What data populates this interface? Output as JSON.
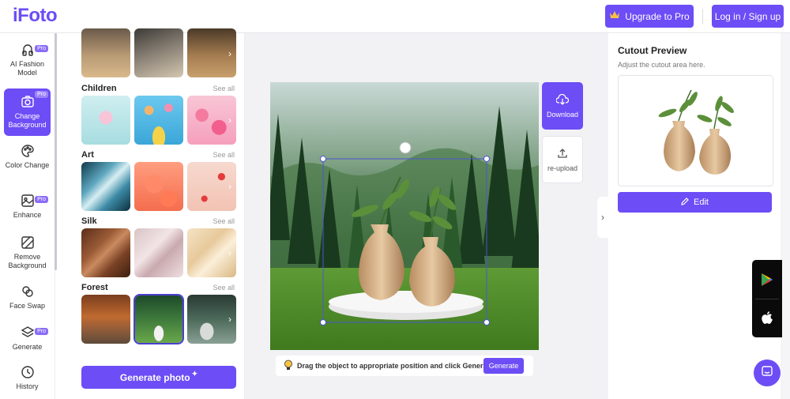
{
  "header": {
    "logo": "iFoto",
    "upgrade_label": "Upgrade to Pro",
    "login_label": "Log in / Sign up"
  },
  "nav": {
    "items": [
      {
        "label": "AI Fashion Model",
        "pro": "Pro",
        "icon": "fashion-model-icon"
      },
      {
        "label": "Change Background",
        "pro": "Pro",
        "icon": "change-background-icon",
        "active": true
      },
      {
        "label": "Color Change",
        "icon": "palette-icon"
      },
      {
        "label": "Enhance",
        "pro": "Pro",
        "icon": "enhance-icon"
      },
      {
        "label": "Remove Background",
        "icon": "remove-background-icon"
      },
      {
        "label": "Face Swap",
        "icon": "face-swap-icon"
      },
      {
        "label": "Generate",
        "pro": "Pro",
        "icon": "layers-icon"
      },
      {
        "label": "History",
        "icon": "clock-icon"
      }
    ]
  },
  "templates": {
    "see_all": "See all",
    "categories": [
      {
        "name": "Children"
      },
      {
        "name": "Art"
      },
      {
        "name": "Silk"
      },
      {
        "name": "Forest"
      }
    ],
    "generate_photo": "Generate photo"
  },
  "canvas": {
    "download_label": "Download",
    "reupload_label": "re-upload",
    "hint_text": "Drag the object to appropriate position and click Generate",
    "hint_generate": "Generate"
  },
  "cutout": {
    "title": "Cutout Preview",
    "subtitle": "Adjust the cutout area here.",
    "edit_label": "Edit"
  },
  "colors": {
    "accent": "#6c4df6"
  }
}
